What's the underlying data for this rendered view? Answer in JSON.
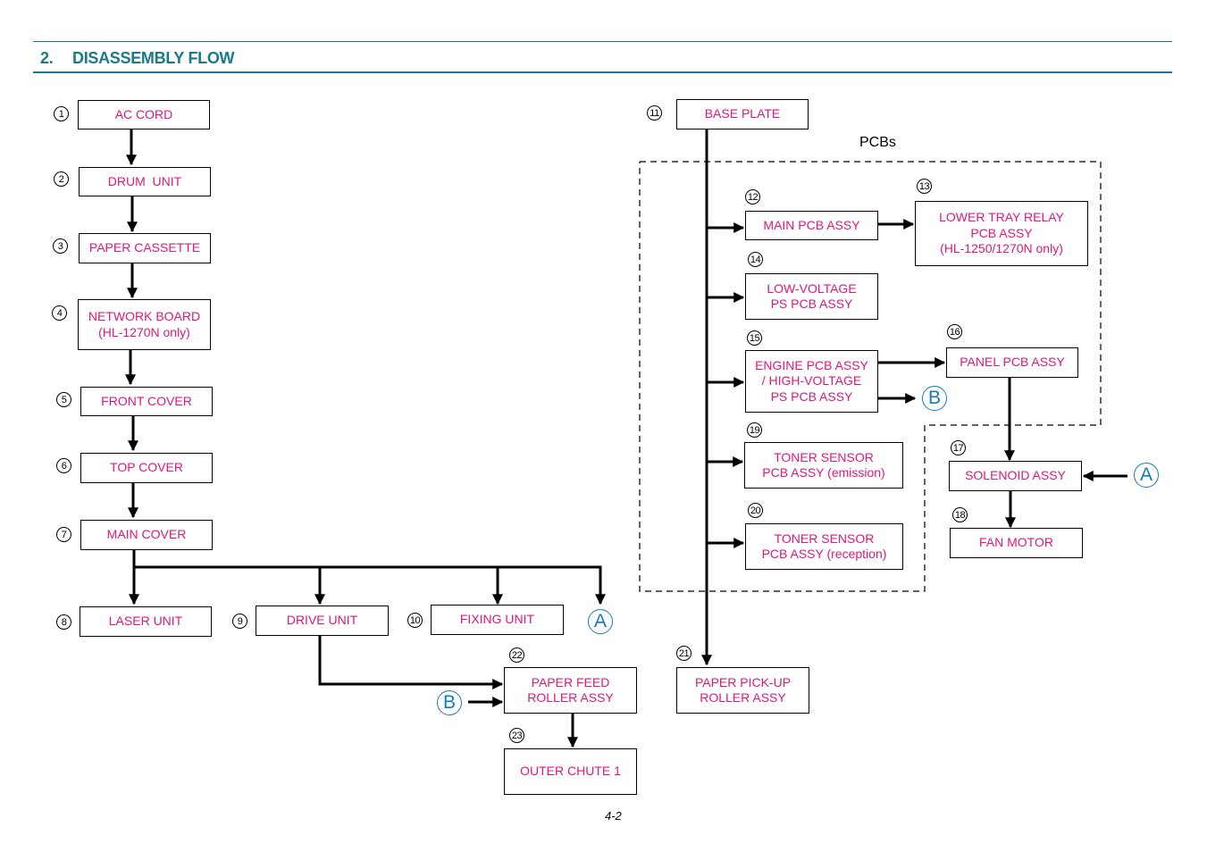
{
  "header": {
    "section_number": "2.",
    "title": "DISASSEMBLY FLOW"
  },
  "colors": {
    "heading": "#1a7a8c",
    "box_text": "#e0187a",
    "connector": "#1a7ab8"
  },
  "steps": [
    {
      "num": "1",
      "label": "AC CORD"
    },
    {
      "num": "2",
      "label": "DRUM  UNIT"
    },
    {
      "num": "3",
      "label": "PAPER CASSETTE"
    },
    {
      "num": "4",
      "label": "NETWORK BOARD\n(HL-1270N only)"
    },
    {
      "num": "5",
      "label": "FRONT COVER"
    },
    {
      "num": "6",
      "label": "TOP COVER"
    },
    {
      "num": "7",
      "label": "MAIN COVER"
    },
    {
      "num": "8",
      "label": "LASER UNIT"
    },
    {
      "num": "9",
      "label": "DRIVE UNIT"
    },
    {
      "num": "10",
      "label": "FIXING UNIT"
    },
    {
      "num": "11",
      "label": "BASE PLATE"
    },
    {
      "num": "12",
      "label": "MAIN PCB ASSY"
    },
    {
      "num": "13",
      "label": "LOWER TRAY RELAY\nPCB ASSY\n(HL-1250/1270N only)"
    },
    {
      "num": "14",
      "label": "LOW-VOLTAGE\nPS PCB ASSY"
    },
    {
      "num": "15",
      "label": "ENGINE PCB ASSY\n/ HIGH-VOLTAGE\nPS PCB ASSY"
    },
    {
      "num": "16",
      "label": "PANEL PCB ASSY"
    },
    {
      "num": "17",
      "label": "SOLENOID ASSY"
    },
    {
      "num": "18",
      "label": "FAN MOTOR"
    },
    {
      "num": "19",
      "label": "TONER SENSOR\nPCB ASSY (emission)"
    },
    {
      "num": "20",
      "label": "TONER SENSOR\nPCB ASSY (reception)"
    },
    {
      "num": "21",
      "label": "PAPER PICK-UP\nROLLER ASSY"
    },
    {
      "num": "22",
      "label": "PAPER FEED\nROLLER ASSY"
    },
    {
      "num": "23",
      "label": "OUTER CHUTE 1"
    }
  ],
  "connectors": {
    "a": "A",
    "b": "B"
  },
  "group_label": "PCBs",
  "page_number": "4-2"
}
